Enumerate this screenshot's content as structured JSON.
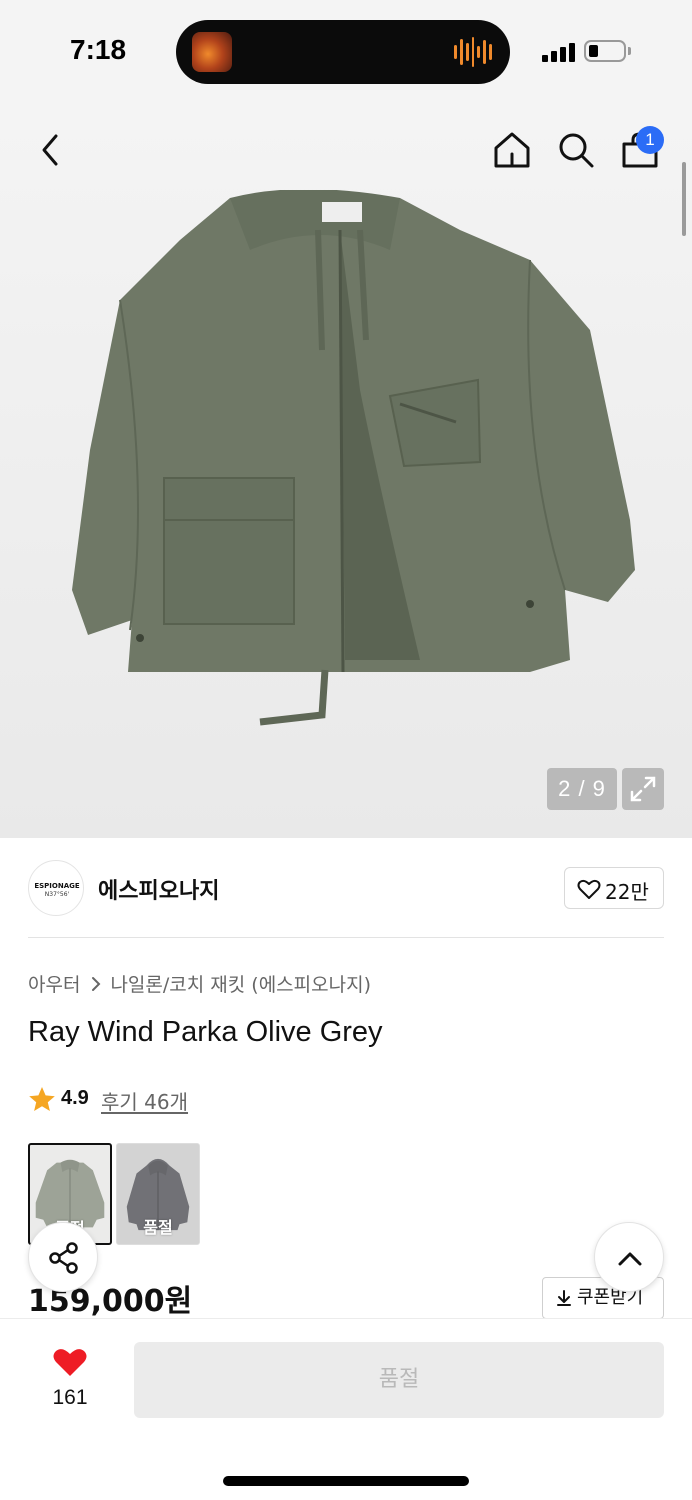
{
  "status_bar": {
    "time": "7:18"
  },
  "header": {
    "icons": [
      "back-icon",
      "home-icon",
      "search-icon",
      "shopping-bag-icon"
    ],
    "cart_badge": "1"
  },
  "gallery": {
    "counter": "2 / 9",
    "expand_icon": "expand-icon"
  },
  "brand": {
    "logo_line1": "ESPIONAGE",
    "logo_line2": "N37°56'",
    "name": "에스피오나지",
    "like_count": "22만"
  },
  "product": {
    "category": "아우터",
    "subcategory": "나일론/코치 재킷 (에스피오나지)",
    "title": "Ray Wind Parka Olive Grey",
    "rating": "4.9",
    "reviews": "후기 46개",
    "options": [
      {
        "label": "품절",
        "color": "#6f7866"
      },
      {
        "label": "품절",
        "color": "#2e2f36"
      }
    ],
    "price": "159,000원",
    "coupon": "쿠폰받기"
  },
  "bottom_bar": {
    "wish_count": "161",
    "buy_label": "품절"
  },
  "colors": {
    "badge": "#2b6cf6",
    "heart": "#ee1c25",
    "star": "#f5a623",
    "jacket": "#6f7866"
  }
}
